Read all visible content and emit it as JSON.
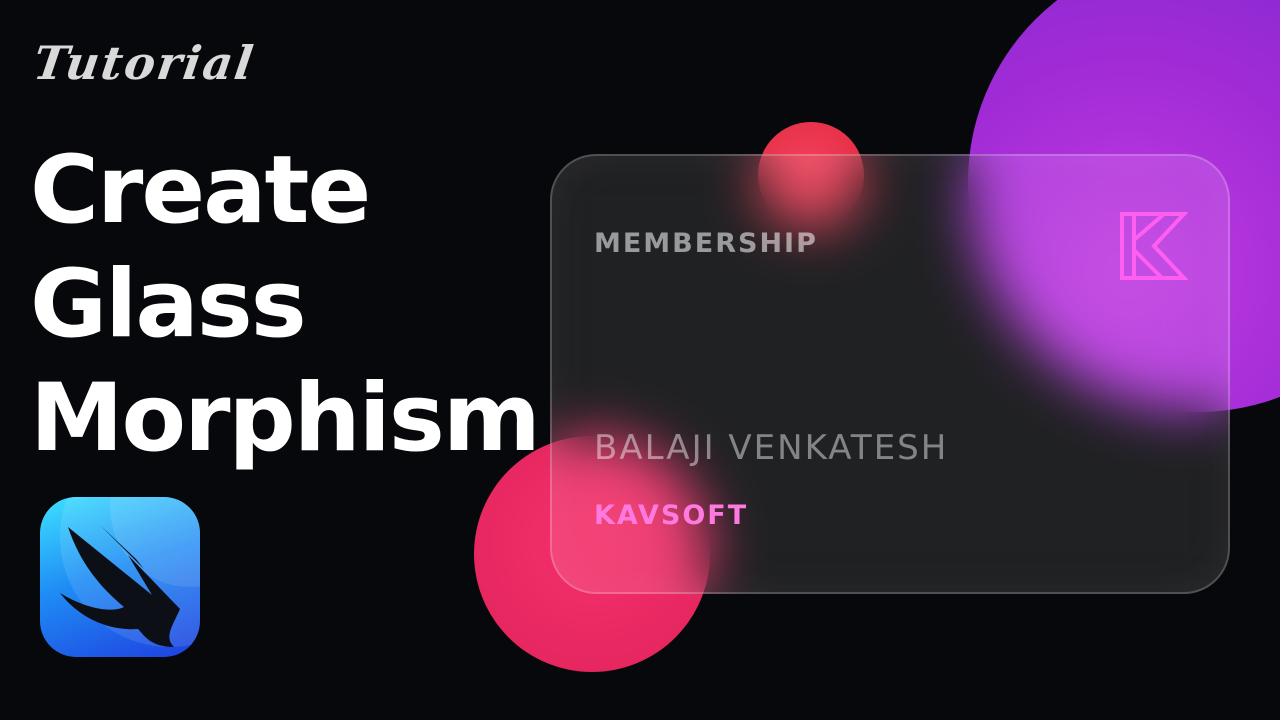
{
  "thumbnail": {
    "tag": "Tutorial",
    "headline": [
      "Create",
      "Glass",
      "Morphism"
    ]
  },
  "card": {
    "label": "MEMBERSHIP",
    "name": "BALAJI VENKATESH",
    "company": "KAVSOFT",
    "logo_icon": "kavsoft-k-logo-icon"
  },
  "app_icon": "swiftui-bird-icon",
  "colors": {
    "background": "#07080b",
    "purple_blob": "#b03ae0",
    "red_blob": "#e2293f",
    "pink_blob": "#e0235c",
    "accent_pink": "#ff7ae0",
    "icon_blue": "#1f8df5"
  }
}
